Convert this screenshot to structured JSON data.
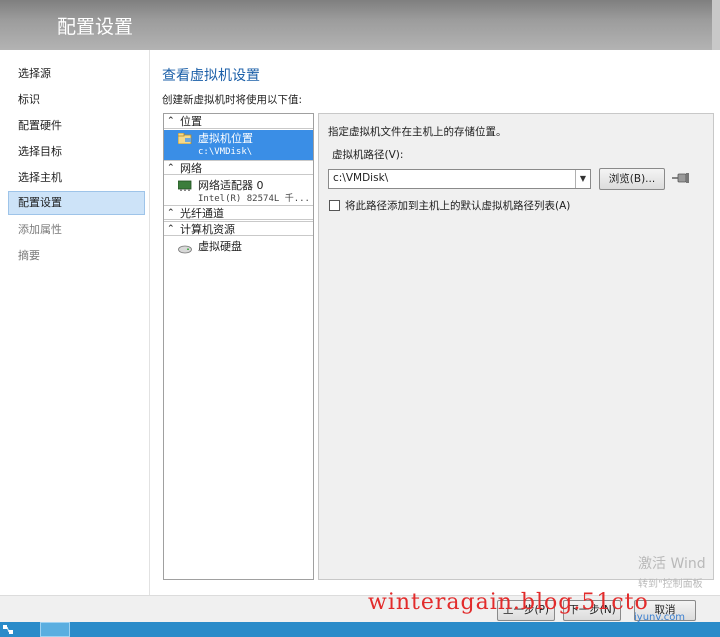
{
  "header": {
    "title": "配置设置"
  },
  "nav": {
    "items": [
      {
        "label": "选择源",
        "state": "normal"
      },
      {
        "label": "标识",
        "state": "normal"
      },
      {
        "label": "配置硬件",
        "state": "normal"
      },
      {
        "label": "选择目标",
        "state": "normal"
      },
      {
        "label": "选择主机",
        "state": "normal"
      },
      {
        "label": "配置设置",
        "state": "active"
      },
      {
        "label": "添加属性",
        "state": "disabled"
      },
      {
        "label": "摘要",
        "state": "disabled"
      }
    ]
  },
  "main": {
    "title": "查看虚拟机设置",
    "subtitle": "创建新虚拟机时将使用以下值:"
  },
  "tree": {
    "groups": {
      "location": "位置",
      "network": "网络",
      "fibre": "光纤通道",
      "compute": "计算机资源"
    },
    "items": {
      "vm_location": {
        "label": "虚拟机位置",
        "value": "c:\\VMDisk\\"
      },
      "network_adapter": {
        "label": "网络适配器 0",
        "value": "Intel(R) 82574L 千..."
      },
      "virtual_disk": {
        "label": "虚拟硬盘"
      }
    }
  },
  "detail": {
    "description": "指定虚拟机文件在主机上的存储位置。",
    "path_label": "虚拟机路径(V):",
    "path_value": "c:\\VMDisk\\",
    "browse_label": "浏览(B)...",
    "checkbox_label": "将此路径添加到主机上的默认虚拟机路径列表(A)",
    "checkbox_checked": false
  },
  "footer": {
    "prev_label": "上一步(P)",
    "next_label": "下一步(N)",
    "cancel_label": "取消"
  },
  "watermarks": {
    "activate": "激活 Wind",
    "activate_sub": "转到\"控制面板",
    "blog": "winteragain.blog.51cto",
    "site": "iyunv.com"
  },
  "colors": {
    "accent": "#1b5fa8",
    "selection": "#3a8ee6",
    "nav_active": "#cde3f8",
    "taskbar": "#2a8bc9"
  }
}
